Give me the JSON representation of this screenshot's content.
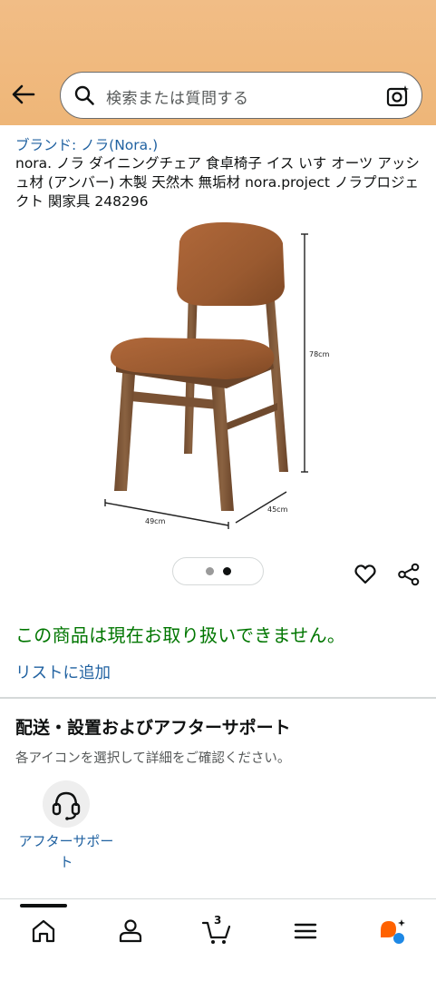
{
  "header": {
    "search_placeholder": "検索または質問する",
    "background_color": "#f0b97e",
    "icons": [
      "back-arrow-icon",
      "search-icon",
      "camera-lens-icon"
    ]
  },
  "product": {
    "brand": "ブランド: ノラ(Nora.)",
    "title": "nora. ノラ ダイニングチェア 食卓椅子 イス いす オーツ アッシュ材 (アンバー) 木製 天然木 無垢材 nora.project ノラプロジェクト 関家具 248296",
    "image": {
      "subject": "chair",
      "dimension_height": "78cm",
      "dimension_width": "49cm",
      "dimension_depth": "45cm"
    },
    "carousel": {
      "total": 2,
      "active_index": 1
    },
    "availability": "この商品は現在お取り扱いできません。",
    "availability_color": "#007600",
    "add_to_list": "リストに追加"
  },
  "delivery_support": {
    "title": "配送・設置およびアフターサポート",
    "subtitle": "各アイコンを選択して詳細をご確認ください。",
    "items": [
      {
        "label": "アフターサポート",
        "icon": "headset-icon"
      }
    ]
  },
  "bottom_nav": {
    "cart_count": "3",
    "items": [
      "home-icon",
      "account-icon",
      "cart-icon",
      "menu-icon",
      "rufus-assistant-icon"
    ]
  },
  "colors": {
    "link": "#2162a1",
    "text": "#0f1111",
    "rufus_orange": "#ff6200",
    "rufus_blue": "#1e88e5"
  }
}
